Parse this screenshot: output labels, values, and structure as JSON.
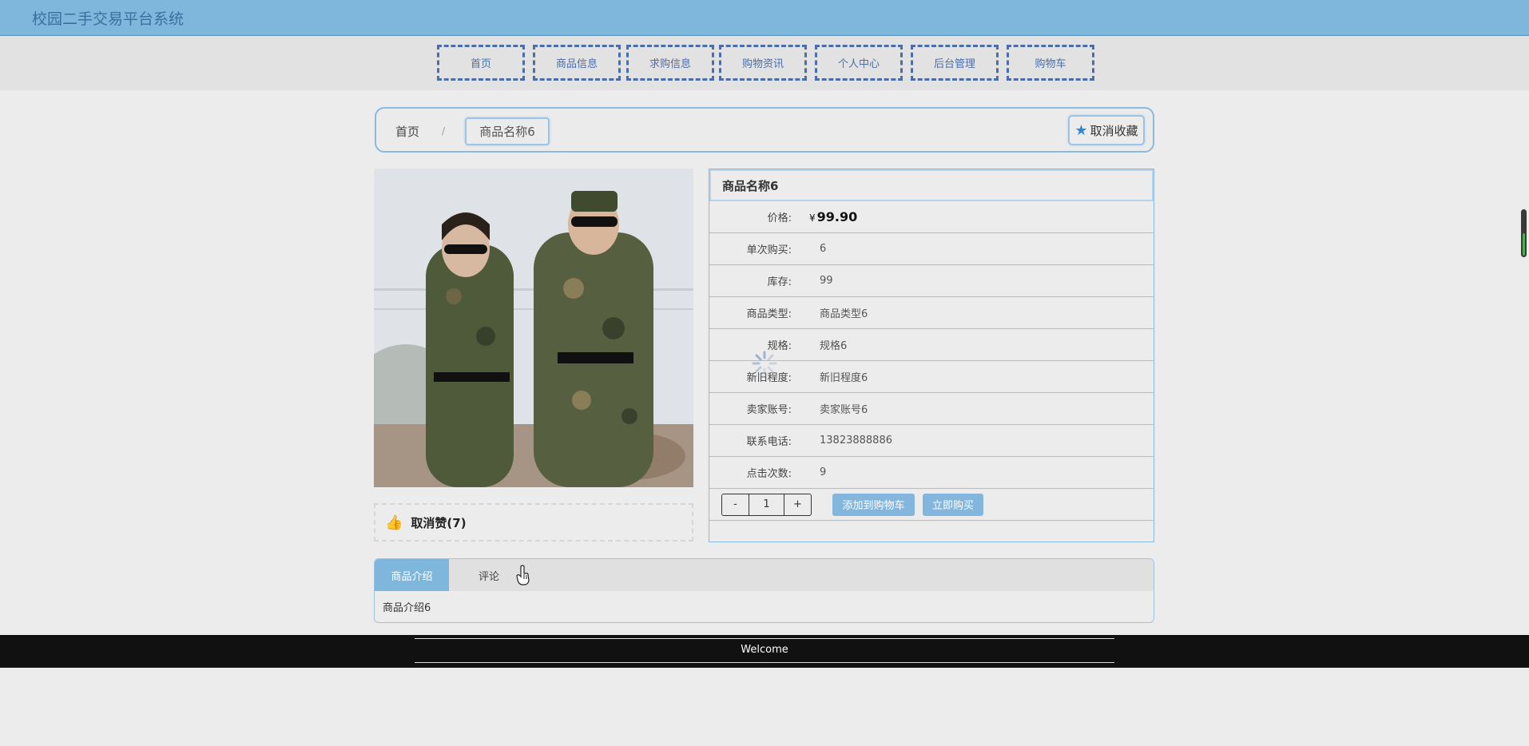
{
  "app": {
    "title": "校园二手交易平台系统"
  },
  "nav": {
    "items": [
      "首页",
      "商品信息",
      "求购信息",
      "购物资讯",
      "个人中心",
      "后台管理",
      "购物车"
    ]
  },
  "breadcrumb": {
    "home": "首页",
    "separator": "/",
    "current": "商品名称6"
  },
  "favorite": {
    "label": "取消收藏",
    "icon": "star-icon"
  },
  "like": {
    "label": "取消赞(7)",
    "icon": "thumbs-up-icon"
  },
  "product": {
    "name": "商品名称6",
    "price_label": "价格:",
    "currency": "¥",
    "price": "99.90",
    "fields": [
      {
        "label": "单次购买:",
        "value": "6"
      },
      {
        "label": "库存:",
        "value": "99"
      },
      {
        "label": "商品类型:",
        "value": "商品类型6"
      },
      {
        "label": "规格:",
        "value": "规格6"
      },
      {
        "label": "新旧程度:",
        "value": "新旧程度6"
      },
      {
        "label": "卖家账号:",
        "value": "卖家账号6"
      },
      {
        "label": "联系电话:",
        "value": "13823888886"
      },
      {
        "label": "点击次数:",
        "value": "9"
      }
    ]
  },
  "purchase": {
    "minus": "-",
    "quantity": "1",
    "plus": "+",
    "add_to_cart": "添加到购物车",
    "buy_now": "立即购买"
  },
  "tabs": {
    "items": [
      "商品介绍",
      "评论"
    ],
    "active_index": 0,
    "content": "商品介绍6"
  },
  "footer": {
    "text": "Welcome"
  },
  "colors": {
    "header": "#7fb6dc",
    "nav_border": "#4b6ea8",
    "accent_blue": "#83b6dd",
    "like_red": "#e0362c",
    "footer": "#111111"
  }
}
